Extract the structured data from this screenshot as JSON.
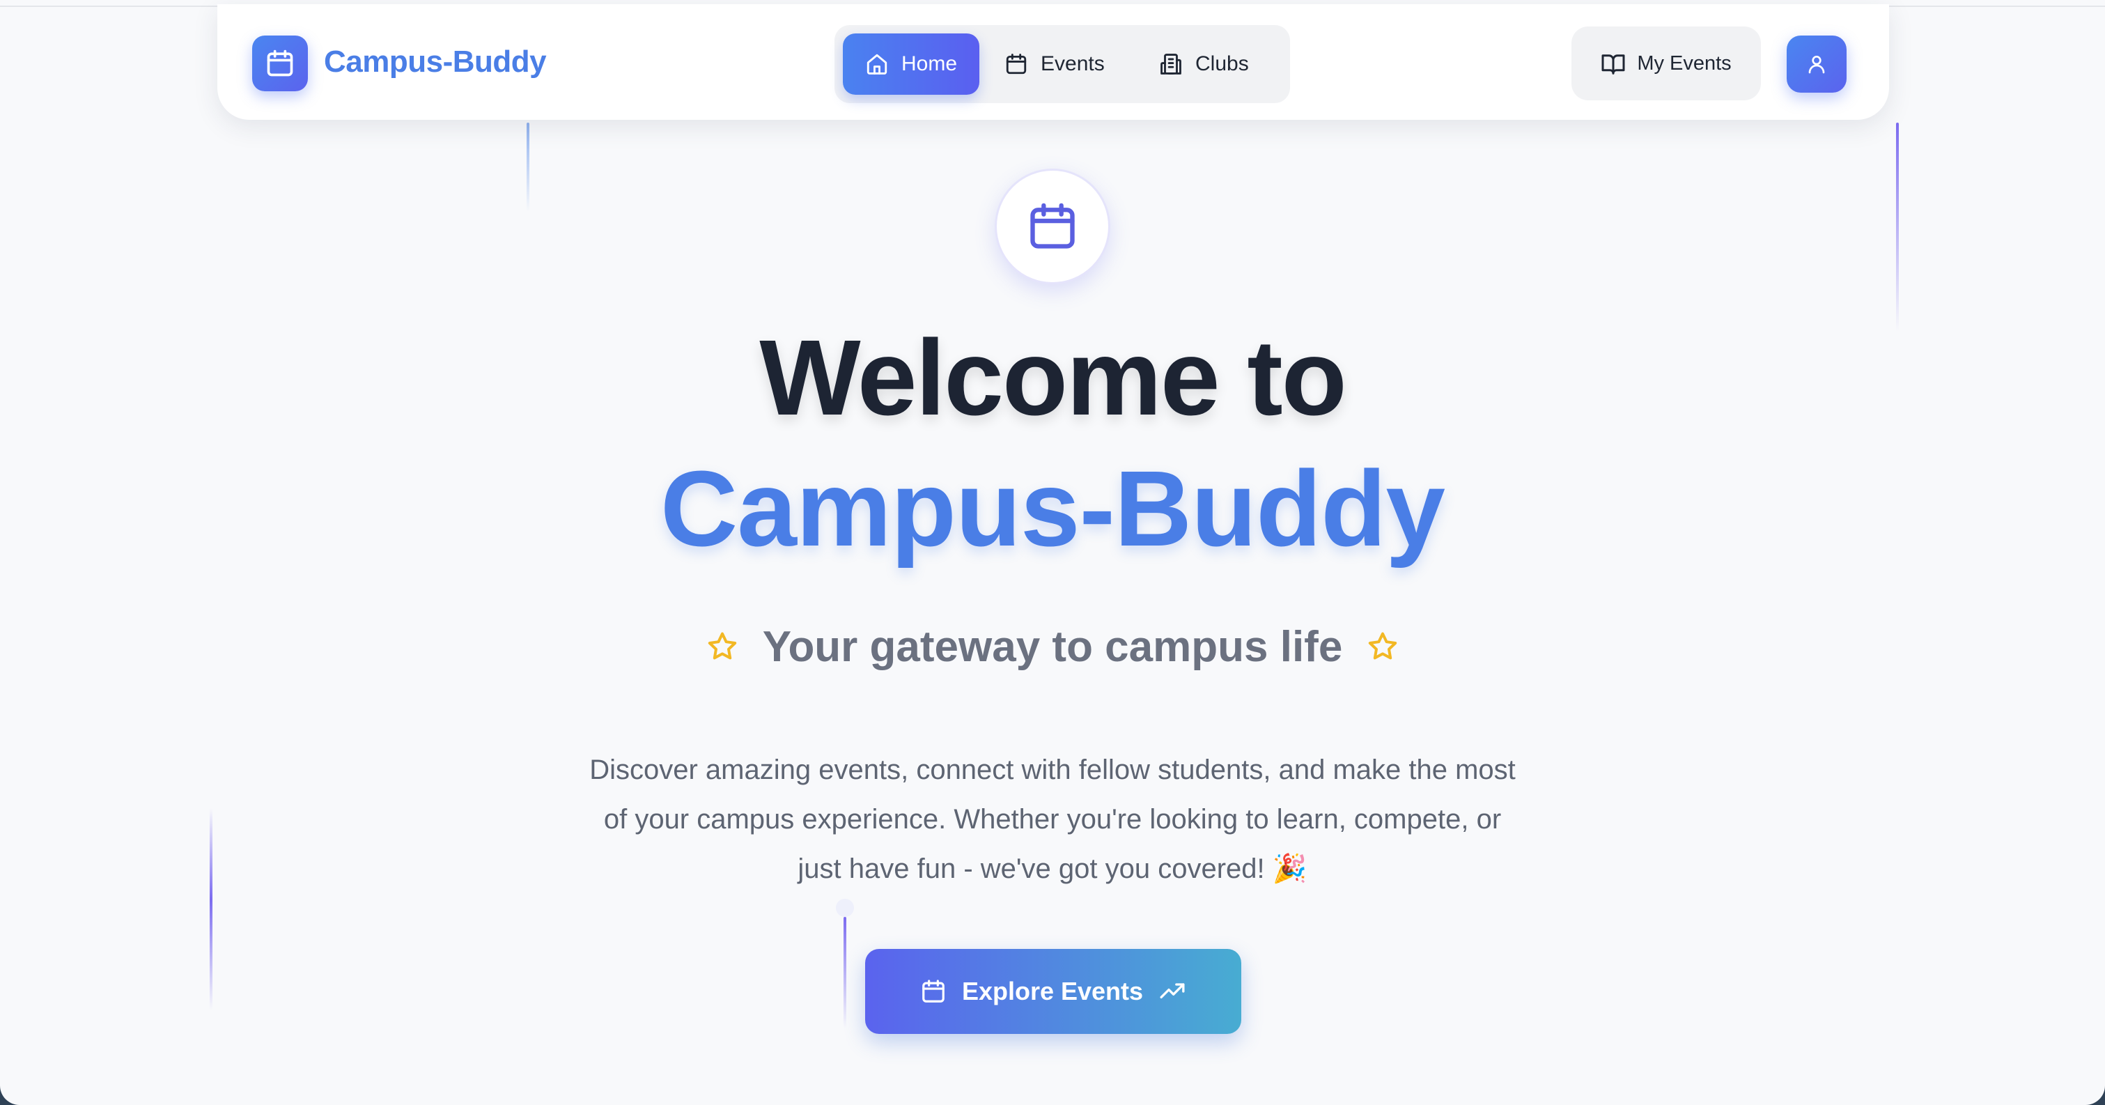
{
  "app": {
    "name": "Campus-Buddy"
  },
  "nav": {
    "items": [
      {
        "label": "Home",
        "icon": "home-icon",
        "active": true
      },
      {
        "label": "Events",
        "icon": "calendar-icon",
        "active": false
      },
      {
        "label": "Clubs",
        "icon": "building-icon",
        "active": false
      }
    ],
    "my_events_label": "My Events",
    "profile_icon": "user-icon"
  },
  "hero": {
    "icon": "calendar-icon",
    "line1": "Welcome to",
    "line2": "Campus-Buddy",
    "tagline": "Your gateway to campus life",
    "tagline_icons": [
      "star-icon",
      "star-icon"
    ],
    "description": "Discover amazing events, connect with fellow students, and make the most of your campus experience. Whether you're looking to learn, compete, or just have fun - we've got you covered! 🎉",
    "cta_label": "Explore Events",
    "cta_icons": [
      "calendar-icon",
      "trending-up-icon"
    ]
  },
  "colors": {
    "accent_blue": "#4a7ee6",
    "accent_indigo": "#5a5ff0",
    "cta_gradient_end": "#48acd2",
    "star": "#f2b824",
    "heading": "#1d2433",
    "muted_text": "#6b7180",
    "background": "#f8f9fb"
  }
}
